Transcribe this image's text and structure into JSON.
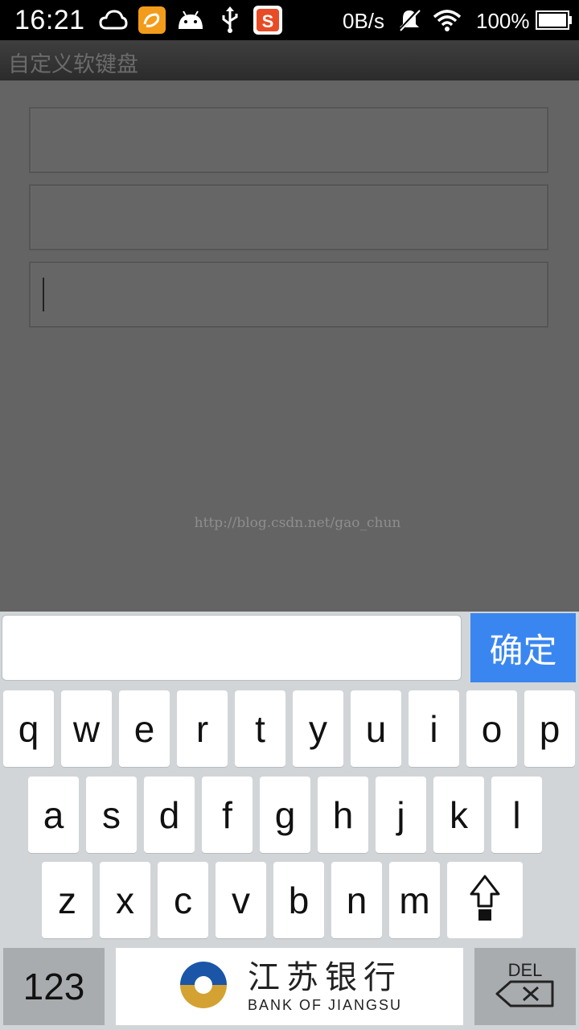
{
  "status_bar": {
    "time": "16:21",
    "net_speed": "0B/s",
    "battery": "100%",
    "icons": [
      "cloud-icon",
      "uc-browser-icon",
      "android-icon",
      "usb-icon",
      "sogou-ime-icon",
      "mute-icon",
      "wifi-icon",
      "battery-icon"
    ]
  },
  "app": {
    "title": "自定义软键盘"
  },
  "fields": [
    {
      "value": ""
    },
    {
      "value": ""
    },
    {
      "value": ""
    }
  ],
  "watermark": "http://blog.csdn.net/gao_chun",
  "keyboard": {
    "input_value": "",
    "confirm_label": "确定",
    "row1": [
      "q",
      "w",
      "e",
      "r",
      "t",
      "y",
      "u",
      "i",
      "o",
      "p"
    ],
    "row2": [
      "a",
      "s",
      "d",
      "f",
      "g",
      "h",
      "j",
      "k",
      "l"
    ],
    "row3": [
      "z",
      "x",
      "c",
      "v",
      "b",
      "n",
      "m"
    ],
    "numbers_label": "123",
    "bank_name_cn": "江苏银行",
    "bank_name_en": "BANK OF JIANGSU",
    "del_label": "DEL",
    "colors": {
      "confirm": "#3a86f0",
      "key": "#ffffff",
      "keyboard_bg": "#d1d5d8",
      "function_key": "#a9acaf"
    }
  }
}
